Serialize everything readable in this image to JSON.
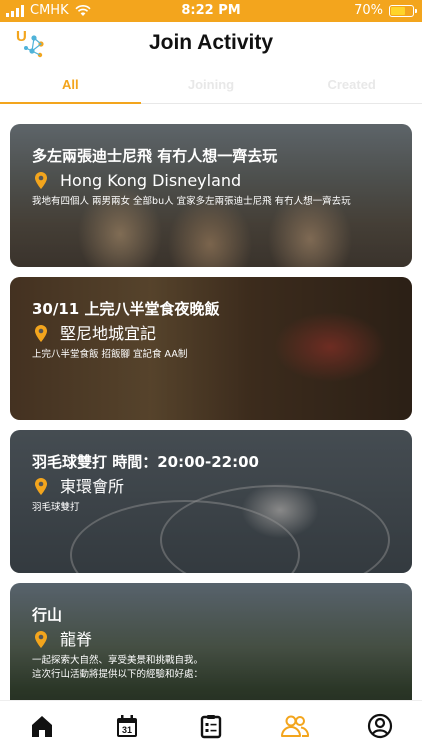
{
  "status": {
    "carrier": "CMHK",
    "time": "8:22 PM",
    "battery": "70%",
    "battery_level": 0.7
  },
  "header": {
    "title": "Join Activity"
  },
  "tabs": [
    {
      "label": "All",
      "active": true
    },
    {
      "label": "Joining",
      "active": false
    },
    {
      "label": "Created",
      "active": false
    }
  ],
  "activities": [
    {
      "title": "多左兩張迪士尼飛 有冇人想一齊去玩",
      "location": "Hong Kong Disneyland",
      "description": "我地有四個人 兩男兩女 全部bu人 宜家多左兩張迪士尼飛 有冇人想一齊去玩"
    },
    {
      "title": "30/11 上完八半堂食夜晚飯",
      "location": "堅尼地城宜記",
      "description": "上完八半堂食飯 招飯腳 宜記食 AA制"
    },
    {
      "title": "羽毛球雙打 時間：20:00-22:00",
      "location": "東環會所",
      "description": "羽毛球雙打"
    },
    {
      "title": "行山",
      "location": "龍脊",
      "description": "一起探索大自然、享受美景和挑戰自我。",
      "description2": "這次行山活動將提供以下的經驗和好處："
    }
  ],
  "colors": {
    "accent": "#f3a51d",
    "pin": "#f3a51d"
  },
  "bottom_nav": [
    "home-icon",
    "calendar-icon",
    "clipboard-icon",
    "people-icon",
    "profile-icon"
  ],
  "calendar_day": "31"
}
